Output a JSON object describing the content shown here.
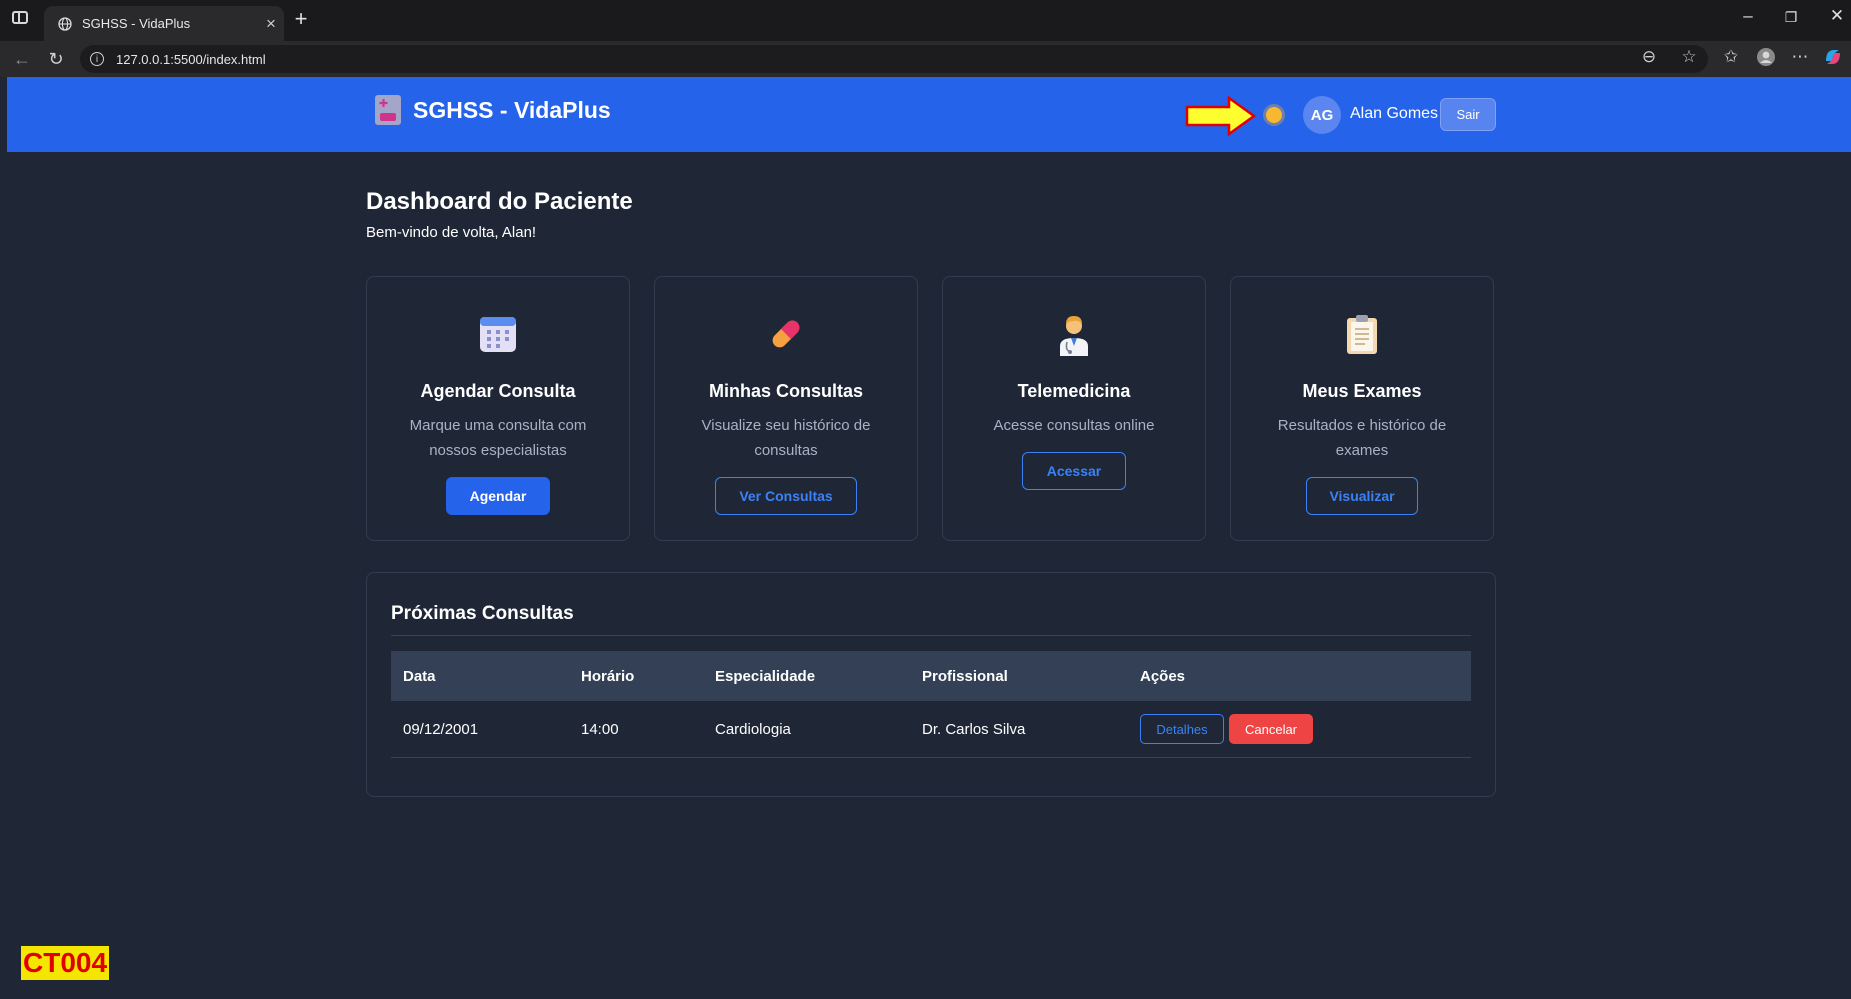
{
  "browser": {
    "tab_title": "SGHSS - VidaPlus",
    "url": "127.0.0.1:5500/index.html"
  },
  "header": {
    "brand": "SGHSS - VidaPlus",
    "theme_toggle_icon": "sun-icon",
    "avatar_initials": "AG",
    "user_name": "Alan Gomes",
    "logout_label": "Sair"
  },
  "main": {
    "title": "Dashboard do Paciente",
    "subtitle": "Bem-vindo de volta, Alan!"
  },
  "cards": [
    {
      "icon": "calendar-icon",
      "title": "Agendar Consulta",
      "description": "Marque uma consulta com nossos especialistas",
      "button": "Agendar"
    },
    {
      "icon": "pill-icon",
      "title": "Minhas Consultas",
      "description": "Visualize seu histórico de consultas",
      "button": "Ver Consultas"
    },
    {
      "icon": "doctor-icon",
      "title": "Telemedicina",
      "description": "Acesse consultas online",
      "button": "Acessar"
    },
    {
      "icon": "clipboard-icon",
      "title": "Meus Exames",
      "description": "Resultados e histórico de exames",
      "button": "Visualizar"
    }
  ],
  "appointments": {
    "title": "Próximas Consultas",
    "columns": [
      "Data",
      "Horário",
      "Especialidade",
      "Profissional",
      "Ações"
    ],
    "rows": [
      {
        "date": "09/12/2001",
        "time": "14:00",
        "specialty": "Cardiologia",
        "professional": "Dr. Carlos Silva",
        "details_label": "Detalhes",
        "cancel_label": "Cancelar"
      }
    ]
  },
  "test_tag": "CT004",
  "colors": {
    "header_bg": "#2563eb",
    "page_bg": "#1f2636",
    "danger": "#ef4444",
    "tag_bg": "#f4e600",
    "tag_text": "#e00000"
  }
}
